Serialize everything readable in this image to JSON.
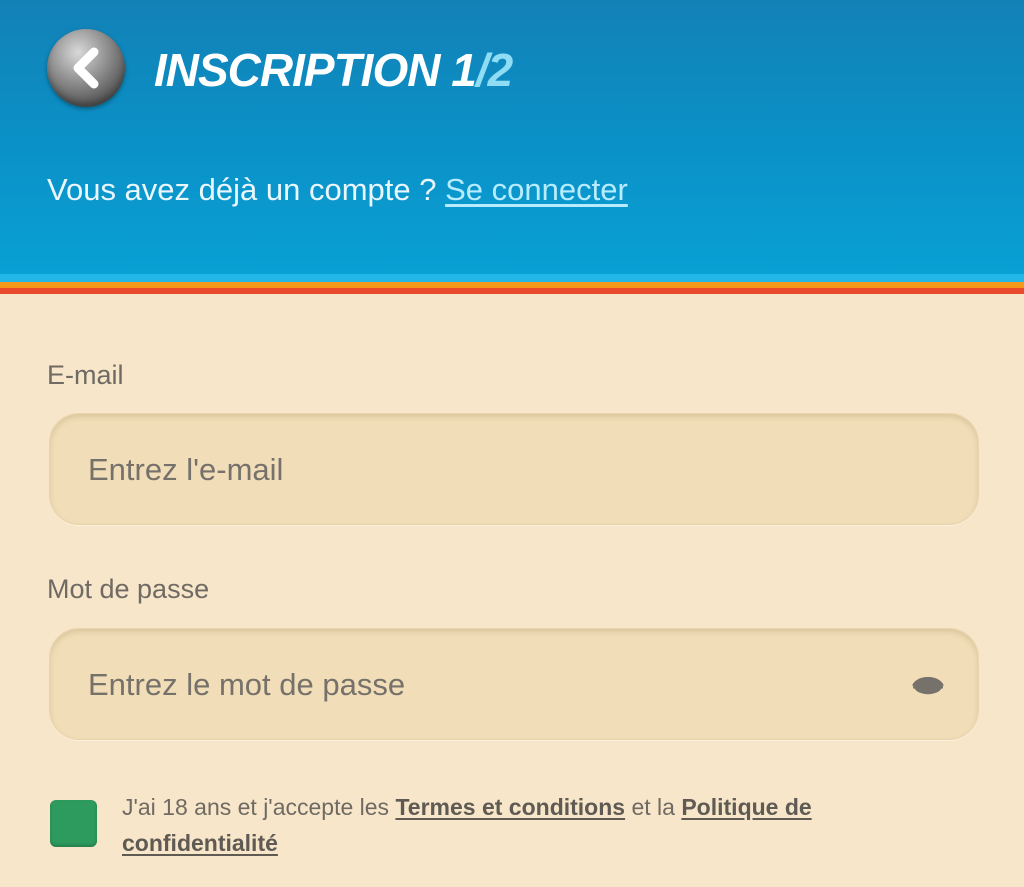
{
  "header": {
    "title_main": "INSCRIPTION 1",
    "title_separator": "/",
    "title_total": "2",
    "account_prompt": "Vous avez déjà un compte ? ",
    "login_link": "Se connecter"
  },
  "form": {
    "email": {
      "label": "E-mail",
      "placeholder": "Entrez l'e-mail",
      "value": ""
    },
    "password": {
      "label": "Mot de passe",
      "placeholder": "Entrez le mot de passe",
      "value": "",
      "toggle_icon": "eye-icon"
    },
    "consent": {
      "checked": true,
      "text_before": "J'ai 18 ans et j'accepte les ",
      "terms_link": "Termes et conditions",
      "text_middle": " et la ",
      "privacy_link": "Politique de confidentialité"
    }
  },
  "icons": {
    "back": "chevron-left-icon"
  },
  "colors": {
    "header_blue": "#0a92c8",
    "stripe_cyan": "#22b7e6",
    "stripe_orange": "#f39a1c",
    "stripe_red": "#e84a2b",
    "page_background": "#f7e6c9",
    "input_background": "#f1deb8",
    "checkbox_green": "#2e9b5e",
    "link_light_blue": "#b7ecff"
  }
}
